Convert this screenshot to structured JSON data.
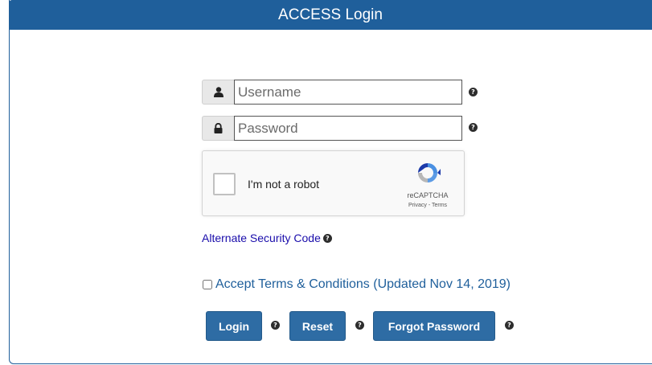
{
  "header": {
    "title": "ACCESS Login"
  },
  "form": {
    "username_placeholder": "Username",
    "password_placeholder": "Password",
    "help_glyph": "?"
  },
  "recaptcha": {
    "label": "I'm not a robot",
    "brand": "reCAPTCHA",
    "links": "Privacy - Terms"
  },
  "alternate_security_code": "Alternate Security Code",
  "terms": {
    "label": "Accept Terms & Conditions (Updated Nov 14, 2019)"
  },
  "buttons": {
    "login": "Login",
    "reset": "Reset",
    "forgot_password": "Forgot Password"
  },
  "colors": {
    "brand": "#1f5f9b",
    "button": "#2e6ca4",
    "link": "#1a0dab"
  },
  "icons": [
    "user-icon",
    "lock-icon",
    "help-icon",
    "recaptcha-logo-icon"
  ]
}
